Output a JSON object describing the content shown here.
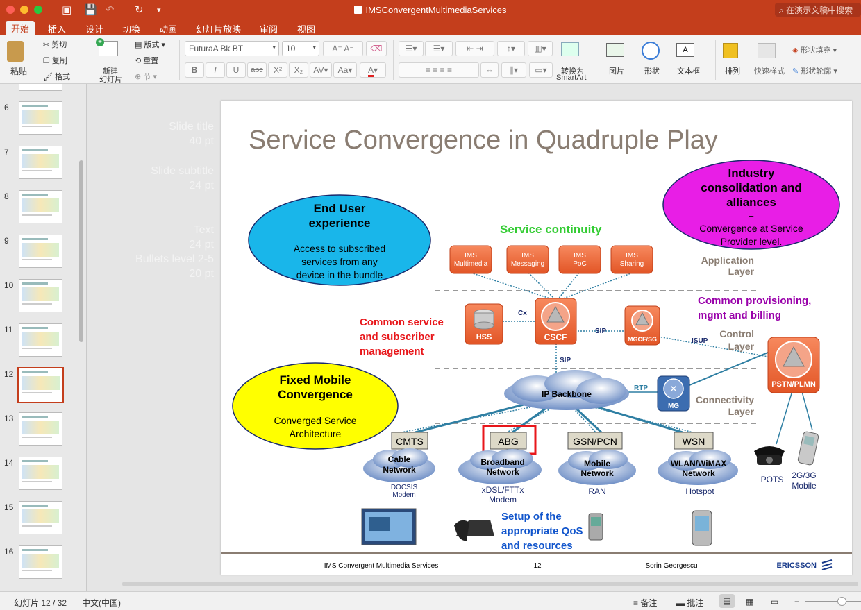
{
  "window": {
    "title": "IMSConvergentMultimediaServices",
    "search_placeholder": "在演示文稿中搜索"
  },
  "tabs": [
    {
      "label": "开始",
      "active": true
    },
    {
      "label": "插入"
    },
    {
      "label": "设计"
    },
    {
      "label": "切换"
    },
    {
      "label": "动画"
    },
    {
      "label": "幻灯片放映"
    },
    {
      "label": "审阅"
    },
    {
      "label": "视图"
    }
  ],
  "ribbon": {
    "paste": "粘贴",
    "cut": "剪切",
    "copy": "复制",
    "format": "格式",
    "new_slide_line1": "新建",
    "new_slide_line2": "幻灯片",
    "layout": "版式",
    "reset": "重置",
    "section": "节",
    "font_name": "FuturaA Bk BT",
    "font_size": "10",
    "bold": "B",
    "italic": "I",
    "underline": "U",
    "strike": "abc",
    "superscript": "X²",
    "subscript": "X₂",
    "smartart_line1": "转换为",
    "smartart_line2": "SmartArt",
    "picture": "图片",
    "shape": "形状",
    "textbox": "文本框",
    "arrange": "排列",
    "quick_styles": "快速样式",
    "shape_fill": "形状填充",
    "shape_outline": "形状轮廓"
  },
  "thumbnails": [
    {
      "num": "6"
    },
    {
      "num": "7"
    },
    {
      "num": "8"
    },
    {
      "num": "9"
    },
    {
      "num": "10"
    },
    {
      "num": "11"
    },
    {
      "num": "12",
      "selected": true
    },
    {
      "num": "13"
    },
    {
      "num": "14"
    },
    {
      "num": "15"
    },
    {
      "num": "16"
    }
  ],
  "ghost_text": {
    "title1": "Slide title",
    "title2": "40 pt",
    "subtitle1": "Slide subtitle",
    "subtitle2": "24 pt",
    "text1": "Text",
    "text2": "24 pt",
    "bullets1": "Bullets level 2-5",
    "bullets2": "20 pt"
  },
  "slide": {
    "title": "Service Convergence in Quadruple Play",
    "end_user": {
      "l1": "End User",
      "l2": "experience",
      "eq": "=",
      "d1": "Access to subscribed",
      "d2": "services from any",
      "d3": "device in the bundle"
    },
    "industry": {
      "l1": "Industry",
      "l2": "consolidation and",
      "l3": "alliances",
      "eq": "=",
      "d1": "Convergence at Service",
      "d2": "Provider level."
    },
    "fmc": {
      "l1": "Fixed Mobile",
      "l2": "Convergence",
      "eq": "=",
      "d1": "Converged Service",
      "d2": "Architecture"
    },
    "service_continuity": "Service continuity",
    "ims_boxes": [
      {
        "l1": "IMS",
        "l2": "Multimedia"
      },
      {
        "l1": "IMS",
        "l2": "Messaging"
      },
      {
        "l1": "IMS",
        "l2": "PoC"
      },
      {
        "l1": "IMS",
        "l2": "Sharing"
      }
    ],
    "app_layer": {
      "l1": "Application",
      "l2": "Layer"
    },
    "control_layer": {
      "l1": "Control",
      "l2": "Layer"
    },
    "conn_layer": {
      "l1": "Connectivity",
      "l2": "Layer"
    },
    "common_prov": {
      "l1": "Common provisioning,",
      "l2": "mgmt and billing"
    },
    "common_service": {
      "l1": "Common service",
      "l2": "and subscriber",
      "l3": "management"
    },
    "hss": "HSS",
    "cscf": "CSCF",
    "mgcf": "MGCF/SG",
    "pstn": "PSTN/PLMN",
    "mg": "MG",
    "cx": "Cx",
    "sip1": "SIP",
    "sip2": "SIP",
    "isup": "ISUP",
    "rtp": "RTP",
    "ip_backbone": "IP Backbone",
    "access": [
      {
        "box": "CMTS",
        "n1": "Cable",
        "n2": "Network",
        "s1": "DOCSIS",
        "s2": "Modem"
      },
      {
        "box": "ABG",
        "n1": "Broadband",
        "n2": "Network",
        "s1": "xDSL/FTTx",
        "s2": "Modem"
      },
      {
        "box": "GSN/PCN",
        "n1": "Mobile",
        "n2": "Network",
        "s1": "RAN",
        "s2": ""
      },
      {
        "box": "WSN",
        "n1": "WLAN/WiMAX",
        "n2": "Network",
        "s1": "Hotspot",
        "s2": ""
      }
    ],
    "pots": "POTS",
    "mobile": {
      "l1": "2G/3G",
      "l2": "Mobile"
    },
    "qos": {
      "l1": "Setup of the",
      "l2": "appropriate QoS",
      "l3": "and resources"
    },
    "footer": {
      "left": "IMS Convergent Multimedia Services",
      "page": "12",
      "author": "Sorin Georgescu",
      "brand": "ERICSSON"
    }
  },
  "status": {
    "slide_info": "幻灯片 12 / 32",
    "language": "中文(中国)",
    "notes": "备注",
    "comments": "批注"
  },
  "colors": {
    "accent": "#c43e1c",
    "ims_orange": "#f06a3f",
    "cyan": "#19b6ea",
    "magenta": "#e81ee6",
    "yellow": "#ffff00",
    "green": "#33cc33",
    "red": "#e8171b",
    "purple": "#9900aa",
    "blue": "#1155cc"
  }
}
